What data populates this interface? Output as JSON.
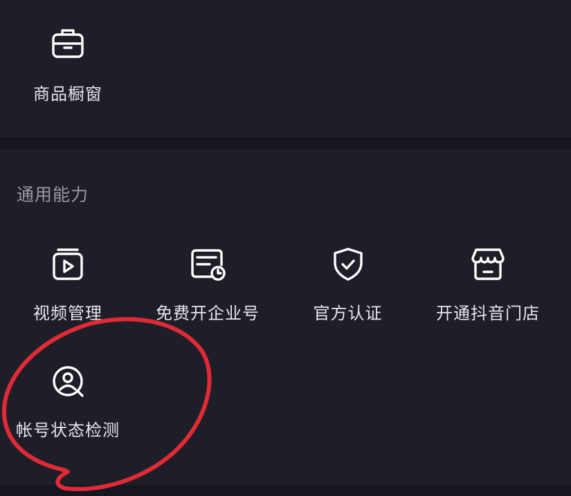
{
  "top_section": {
    "items": [
      {
        "label": "商品橱窗",
        "icon": "briefcase-icon"
      }
    ]
  },
  "general_section": {
    "title": "通用能力",
    "items": [
      {
        "label": "视频管理",
        "icon": "video-manage-icon"
      },
      {
        "label": "免费开企业号",
        "icon": "enterprise-card-icon"
      },
      {
        "label": "官方认证",
        "icon": "shield-check-icon"
      },
      {
        "label": "开通抖音门店",
        "icon": "store-icon"
      },
      {
        "label": "帐号状态检测",
        "icon": "user-search-icon"
      }
    ]
  },
  "colors": {
    "background": "#161620",
    "panel": "#1e1e29",
    "label": "#e6e6ea",
    "section_title": "#9a9aa4",
    "annotation": "#e02a36"
  }
}
